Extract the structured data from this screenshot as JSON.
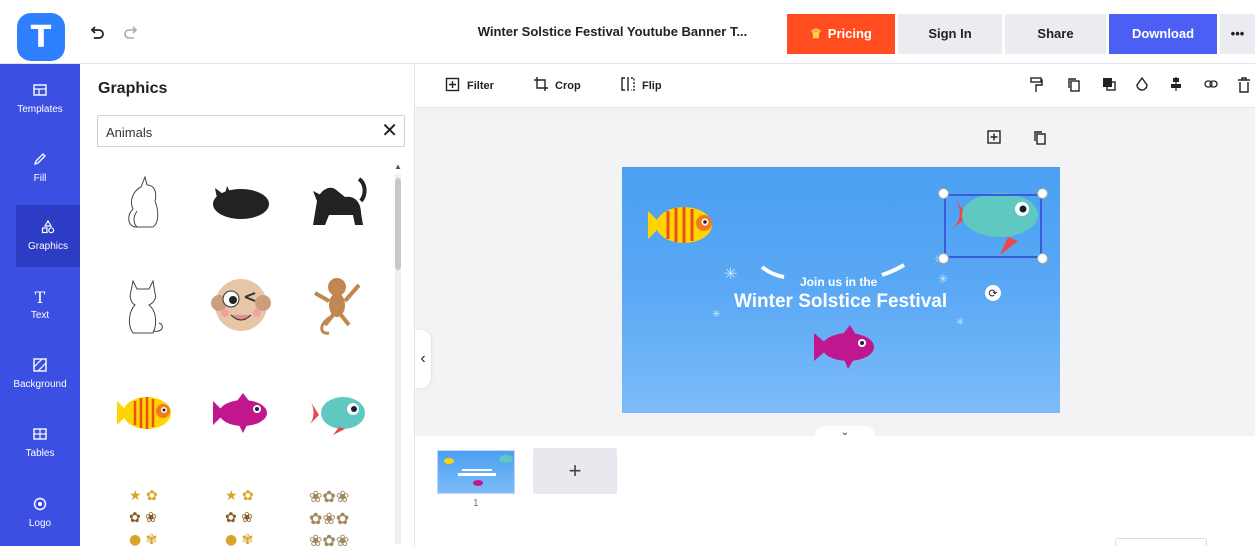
{
  "header": {
    "logo_letter": "T",
    "doc_title": "Winter Solstice Festival Youtube Banner T...",
    "pricing_label": "Pricing",
    "signin_label": "Sign In",
    "share_label": "Share",
    "download_label": "Download",
    "more_label": "•••"
  },
  "sidebar": {
    "items": [
      {
        "label": "Templates",
        "icon": "templates-icon"
      },
      {
        "label": "Fill",
        "icon": "pencil-icon"
      },
      {
        "label": "Graphics",
        "icon": "shapes-icon",
        "active": true
      },
      {
        "label": "Text",
        "icon": "text-icon"
      },
      {
        "label": "Background",
        "icon": "background-icon"
      },
      {
        "label": "Tables",
        "icon": "table-icon"
      },
      {
        "label": "Logo",
        "icon": "logo-icon"
      }
    ]
  },
  "graphics_panel": {
    "title": "Graphics",
    "search_value": "Animals",
    "clear_symbol": "✕"
  },
  "toolbar": {
    "filter_label": "Filter",
    "crop_label": "Crop",
    "flip_label": "Flip",
    "right_icons": [
      "paint-roller-icon",
      "duplicate-icon",
      "arrange-icon",
      "opacity-icon",
      "align-icon",
      "link-icon",
      "trash-icon"
    ]
  },
  "banner": {
    "subtitle": "Join us in the",
    "title": "Winter Solstice Festival"
  },
  "pages": {
    "thumbnail_number": "1",
    "add_symbol": "+"
  },
  "colors": {
    "brand": "#3b4fe3",
    "pricing": "#ff4d1f",
    "download": "#4b5ff5",
    "canvas_blue": "#5aa8f5"
  }
}
